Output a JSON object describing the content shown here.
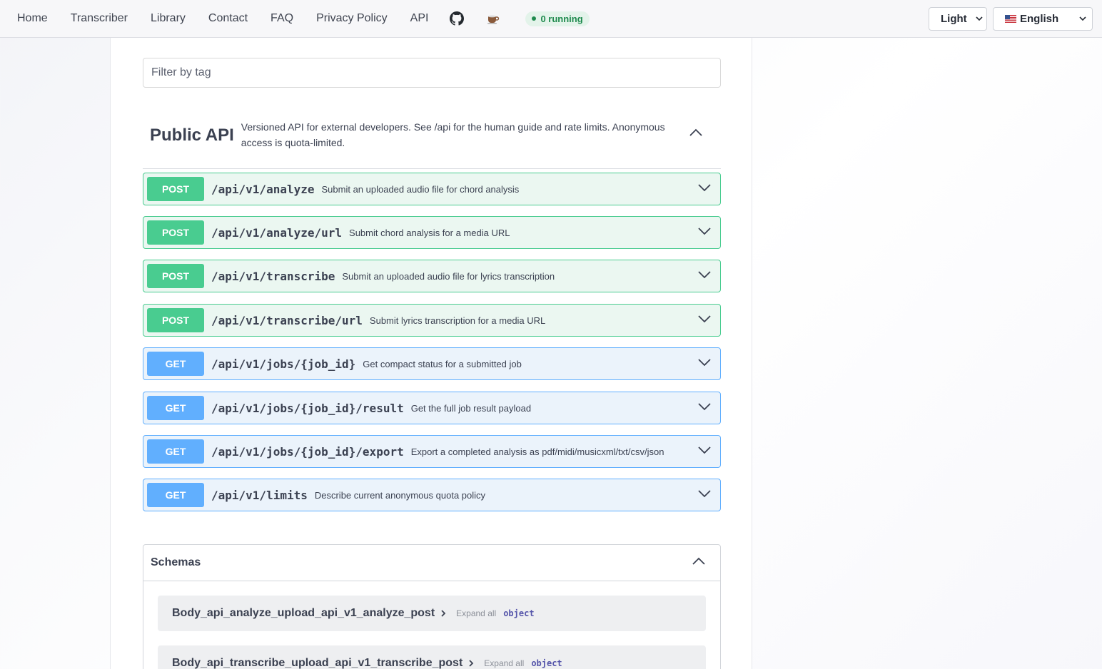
{
  "nav": {
    "links": [
      "Home",
      "Transcriber",
      "Library",
      "Contact",
      "FAQ",
      "Privacy Policy",
      "API"
    ],
    "github_icon": "github-icon",
    "coffee_icon": "coffee-icon",
    "running_badge": "0 running",
    "theme_select": "Light",
    "language_select": "English",
    "language_flag": "us-flag-icon"
  },
  "filter": {
    "placeholder": "Filter by tag"
  },
  "tag": {
    "title": "Public API",
    "description": "Versioned API for external developers. See /api for the human guide and rate limits. Anonymous access is quota-limited."
  },
  "operations": [
    {
      "method": "POST",
      "path": "/api/v1/analyze",
      "summary": "Submit an uploaded audio file for chord analysis"
    },
    {
      "method": "POST",
      "path": "/api/v1/analyze/url",
      "summary": "Submit chord analysis for a media URL"
    },
    {
      "method": "POST",
      "path": "/api/v1/transcribe",
      "summary": "Submit an uploaded audio file for lyrics transcription"
    },
    {
      "method": "POST",
      "path": "/api/v1/transcribe/url",
      "summary": "Submit lyrics transcription for a media URL"
    },
    {
      "method": "GET",
      "path": "/api/v1/jobs/{job_id}",
      "summary": "Get compact status for a submitted job"
    },
    {
      "method": "GET",
      "path": "/api/v1/jobs/{job_id}/result",
      "summary": "Get the full job result payload"
    },
    {
      "method": "GET",
      "path": "/api/v1/jobs/{job_id}/export",
      "summary": "Export a completed analysis as pdf/midi/musicxml/txt/csv/json"
    },
    {
      "method": "GET",
      "path": "/api/v1/limits",
      "summary": "Describe current anonymous quota policy"
    }
  ],
  "schemas": {
    "title": "Schemas",
    "models": [
      {
        "name": "Body_api_analyze_upload_api_v1_analyze_post",
        "expand": "Expand all",
        "type": "object"
      },
      {
        "name": "Body_api_transcribe_upload_api_v1_transcribe_post",
        "expand": "Expand all",
        "type": "object"
      }
    ]
  },
  "colors": {
    "post": "#49cc90",
    "get": "#61affe",
    "running": "#1e8a4d"
  }
}
